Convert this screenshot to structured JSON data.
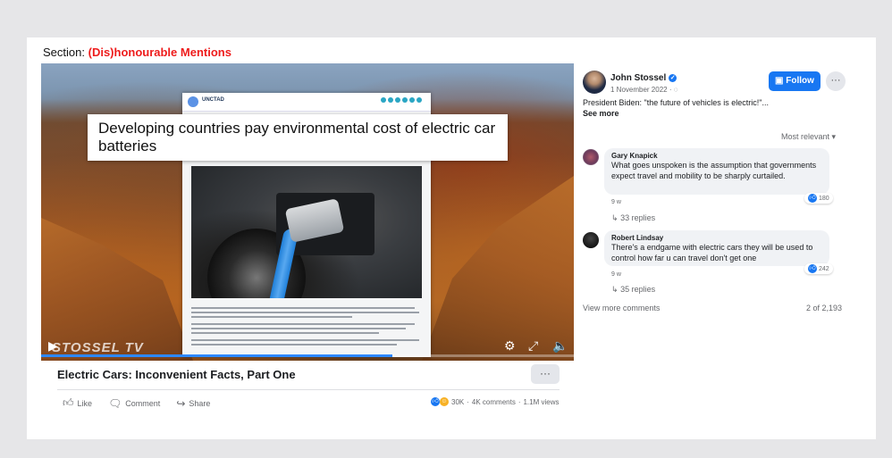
{
  "section": {
    "prefix": "Section:",
    "highlight": "(Dis)honourable Mentions"
  },
  "video": {
    "headline": "Developing countries pay environmental cost of electric car batteries",
    "document_org": "UNCTAD",
    "watermark": "STOSSEL TV",
    "progress": 0.66,
    "title": "Electric Cars: Inconvenient Facts, Part One",
    "more_label": "···"
  },
  "actions": {
    "like": "Like",
    "comment": "Comment",
    "share": "Share"
  },
  "stats": {
    "reactions": "30K",
    "comments": "4K comments",
    "views": "1.1M views",
    "separator": "·"
  },
  "post": {
    "author": "John Stossel",
    "date": "1 November 2022 · ",
    "follow_label": "Follow",
    "more_label": "···",
    "text": "President Biden: \"the future of vehicles is electric!\"...",
    "see_more": "See more",
    "sort_label": "Most relevant"
  },
  "comments": [
    {
      "name": "Gary Knapick",
      "text": "What goes unspoken is the assumption that governments expect travel and mobility to be sharply curtailed.",
      "time": "9 w",
      "reactions": "180",
      "replies": "33 replies"
    },
    {
      "name": "Robert Lindsay",
      "text": "There's a endgame with electric cars they will be used to control how far u can travel don't get one",
      "time": "9 w",
      "reactions": "242",
      "replies": "35 replies"
    }
  ],
  "footer": {
    "view_more": "View more comments",
    "count": "2 of 2,193"
  },
  "colors": {
    "accent": "#ee1c1c",
    "facebook_blue": "#1877f2",
    "bubble": "#f0f2f5"
  }
}
